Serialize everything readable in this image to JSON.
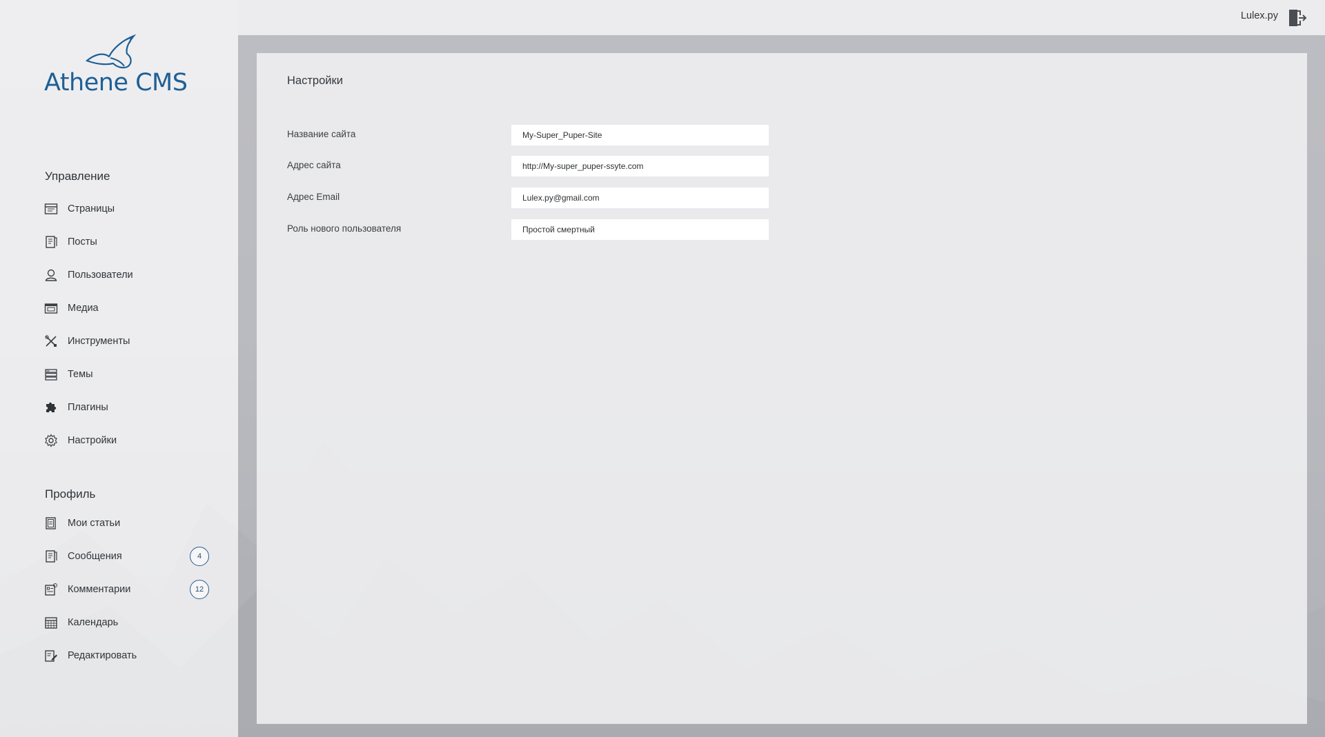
{
  "brand": {
    "name": "Athene CMS"
  },
  "topbar": {
    "user": "Lulex.py"
  },
  "sidebar": {
    "management_title": "Управление",
    "management_items": [
      {
        "label": "Страницы",
        "icon": "pages-icon"
      },
      {
        "label": "Посты",
        "icon": "posts-icon"
      },
      {
        "label": "Пользователи",
        "icon": "user-icon"
      },
      {
        "label": "Медиа",
        "icon": "media-icon"
      },
      {
        "label": "Инструменты",
        "icon": "tools-icon"
      },
      {
        "label": "Темы",
        "icon": "themes-icon"
      },
      {
        "label": "Плагины",
        "icon": "puzzle-icon"
      },
      {
        "label": "Настройки",
        "icon": "gear-icon"
      }
    ],
    "profile_title": "Профиль",
    "profile_items": [
      {
        "label": "Мои статьи",
        "icon": "articles-icon"
      },
      {
        "label": "Сообщения",
        "icon": "messages-icon",
        "badge": "4"
      },
      {
        "label": "Комментарии",
        "icon": "comments-icon",
        "badge": "12"
      },
      {
        "label": "Календарь",
        "icon": "calendar-icon"
      },
      {
        "label": "Редактировать",
        "icon": "edit-icon"
      }
    ]
  },
  "main": {
    "title": "Настройки",
    "fields": [
      {
        "label": "Название сайта",
        "value": "My-Super_Puper-Site"
      },
      {
        "label": "Адрес сайта",
        "value": "http://My-super_puper-ssyte.com"
      },
      {
        "label": "Адрес Email",
        "value": "Lulex.py@gmail.com"
      },
      {
        "label": "Роль нового пользователя",
        "value": "Простой смертный"
      }
    ]
  },
  "colors": {
    "brand": "#1f5f95",
    "badge_border": "#2b5e8e"
  }
}
